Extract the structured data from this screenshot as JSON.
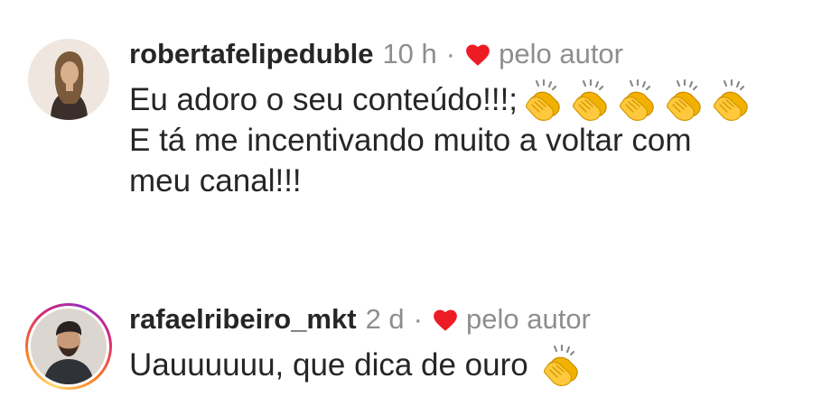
{
  "comments": [
    {
      "username": "robertafelipeduble",
      "time": "10 h",
      "separator": "·",
      "liked_by_author": "pelo autor",
      "lines": [
        "Eu adoro o seu conteúdo!!!;",
        "E tá me incentivando muito a voltar com",
        "meu canal!!!"
      ],
      "emoji_count_line1": 5
    },
    {
      "username": "rafaelribeiro_mkt",
      "time": "2 d",
      "separator": "·",
      "liked_by_author": "pelo autor",
      "lines": [
        "Uauuuuuu, que dica de ouro"
      ]
    }
  ],
  "colors": {
    "heart": "#ed1c24",
    "muted": "#8e8e8e",
    "text": "#262626"
  },
  "icons": {
    "heart": "heart-icon",
    "emoji": "clapping-hands-emoji"
  }
}
